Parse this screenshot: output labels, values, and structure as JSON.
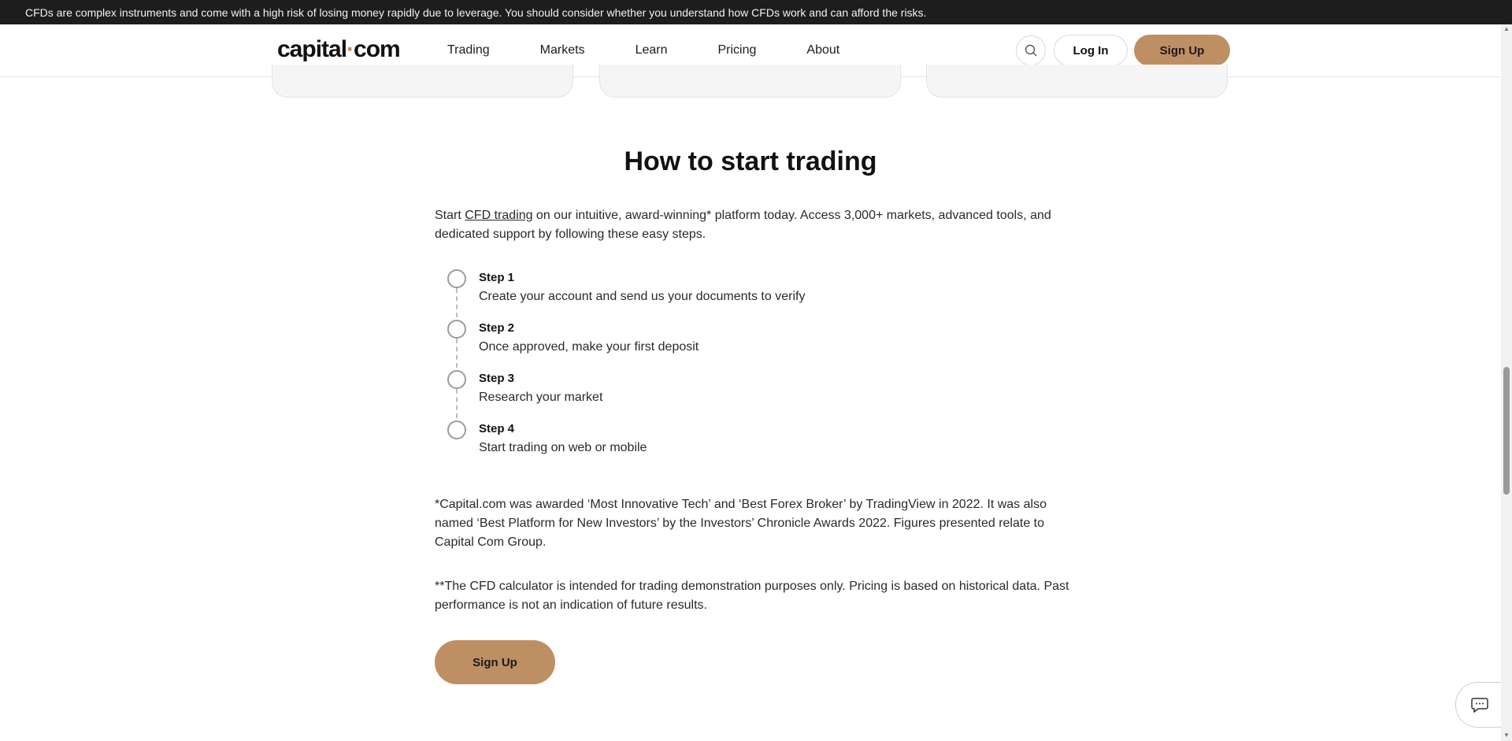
{
  "risk_banner": "CFDs are complex instruments and come with a high risk of losing money rapidly due to leverage. You should consider whether you understand how CFDs work and can afford the risks.",
  "header": {
    "logo_left": "capital",
    "logo_dot": "·",
    "logo_right": "com",
    "nav": [
      "Trading",
      "Markets",
      "Learn",
      "Pricing",
      "About"
    ],
    "login": "Log In",
    "signup": "Sign Up"
  },
  "main": {
    "title": "How to start trading",
    "intro_before": "Start ",
    "intro_link": "CFD trading",
    "intro_after": " on our intuitive, award-winning* platform today. Access 3,000+ markets, advanced tools, and dedicated support by following these easy steps.",
    "steps": [
      {
        "title": "Step 1",
        "desc": "Create your account and send us your documents to verify"
      },
      {
        "title": "Step 2",
        "desc": "Once approved, make your first deposit"
      },
      {
        "title": "Step 3",
        "desc": "Research your market"
      },
      {
        "title": "Step 4",
        "desc": "Start trading on web or mobile"
      }
    ],
    "note1": "*Capital.com was awarded ‘Most Innovative Tech’ and ‘Best Forex Broker’ by TradingView in 2022. It was also named ‘Best Platform for New Investors’ by the Investors’ Chronicle Awards 2022. Figures presented relate to Capital Com Group.",
    "note2": "**The CFD calculator is intended for trading demonstration purposes only. Pricing is based on historical data. Past performance is not an indication of future results.",
    "signup": "Sign Up"
  },
  "icons": {
    "search": "search-icon",
    "chat": "chat-icon"
  },
  "colors": {
    "accent": "#bf8f64",
    "banner_bg": "#1d1d1d"
  }
}
